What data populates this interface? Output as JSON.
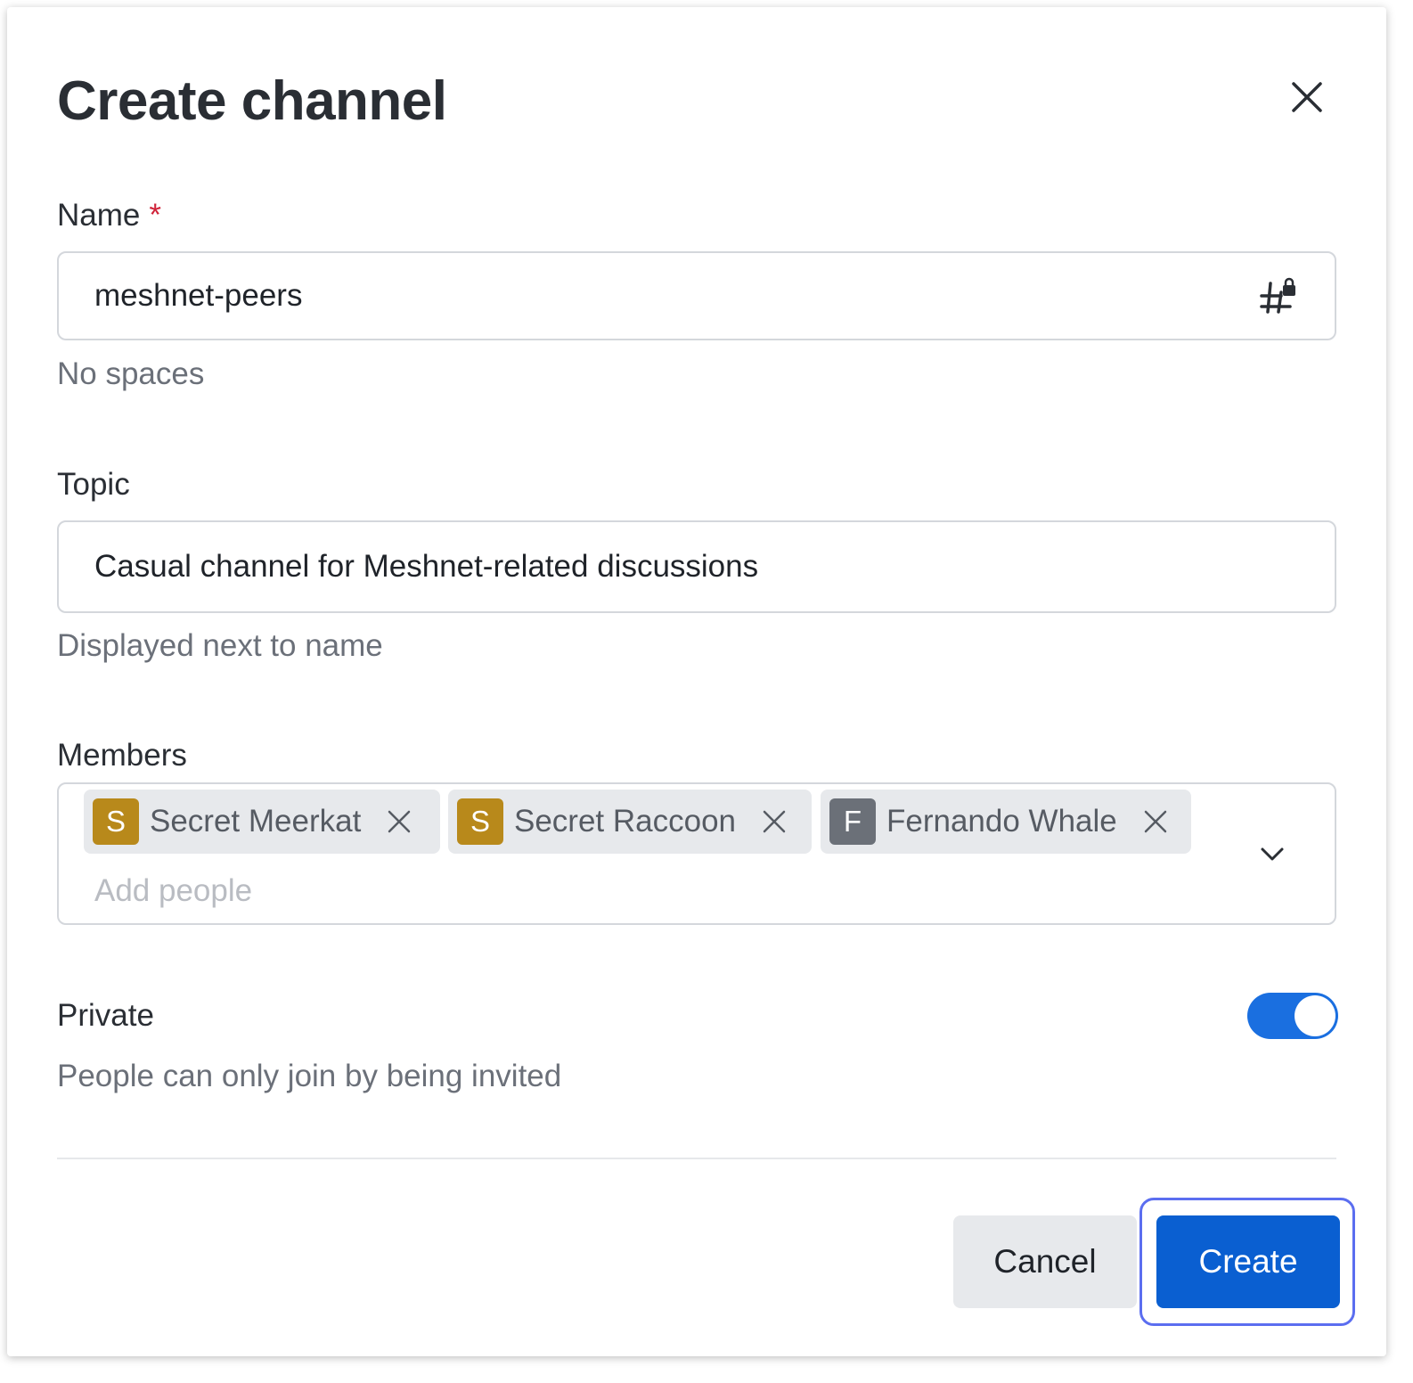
{
  "dialog": {
    "title": "Create channel"
  },
  "name_field": {
    "label": "Name",
    "required_marker": "*",
    "value": "meshnet-peers",
    "hint": "No spaces",
    "icon": "private-channel-icon"
  },
  "topic_field": {
    "label": "Topic",
    "value": "Casual channel for Meshnet-related discussions",
    "hint": "Displayed next to name"
  },
  "members_field": {
    "label": "Members",
    "placeholder": "Add people",
    "chips": [
      {
        "initial": "S",
        "name": "Secret Meerkat",
        "avatar_color": "#b8891b"
      },
      {
        "initial": "S",
        "name": "Secret Raccoon",
        "avatar_color": "#b8891b"
      },
      {
        "initial": "F",
        "name": "Fernando Whale",
        "avatar_color": "#6b7078"
      }
    ]
  },
  "private_setting": {
    "label": "Private",
    "description": "People can only join by being invited",
    "enabled": true
  },
  "actions": {
    "cancel_label": "Cancel",
    "create_label": "Create"
  },
  "colors": {
    "accent": "#0a5fd1",
    "toggle_on": "#1a6fe0",
    "required": "#d0243a",
    "focus_ring": "#5b6ef0"
  }
}
